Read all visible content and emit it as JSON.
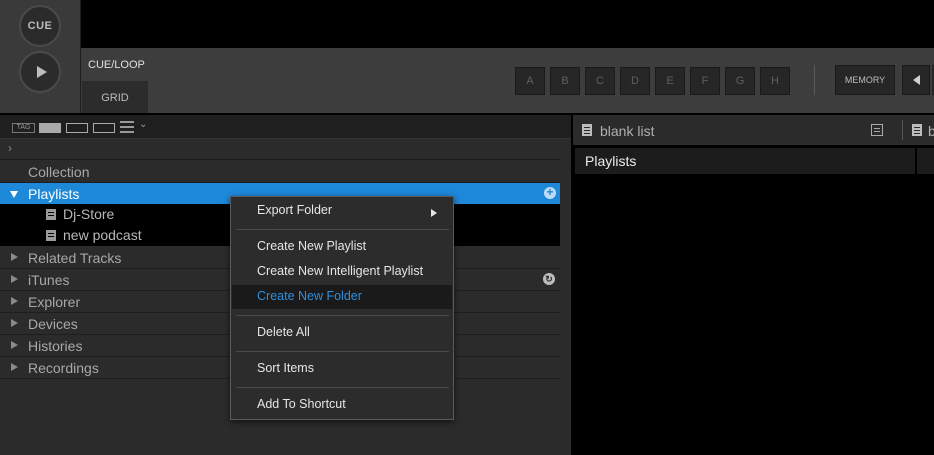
{
  "deck": {
    "cue_label": "CUE",
    "tabs": {
      "cue_loop": "CUE/LOOP",
      "grid": "GRID"
    },
    "hot_cues": [
      "A",
      "B",
      "C",
      "D",
      "E",
      "F",
      "G",
      "H"
    ],
    "memory_label": "MEMORY"
  },
  "tree": {
    "toolbar": {
      "tag_label": "TAG"
    },
    "items": [
      {
        "label": "Collection"
      },
      {
        "label": "Playlists"
      },
      {
        "label": "Related Tracks"
      },
      {
        "label": "iTunes"
      },
      {
        "label": "Explorer"
      },
      {
        "label": "Devices"
      },
      {
        "label": "Histories"
      },
      {
        "label": "Recordings"
      }
    ],
    "playlists": [
      {
        "label": "Dj-Store"
      },
      {
        "label": "new podcast"
      }
    ]
  },
  "right_panel": {
    "title": "blank list",
    "title2_fragment": "b",
    "column_header": "Playlists"
  },
  "context_menu": {
    "items": [
      {
        "label": "Export Folder",
        "submenu": true
      },
      {
        "label": "Create New Playlist"
      },
      {
        "label": "Create New Intelligent Playlist"
      },
      {
        "label": "Create New Folder",
        "highlighted": true
      },
      {
        "label": "Delete All"
      },
      {
        "label": "Sort Items"
      },
      {
        "label": "Add To Shortcut"
      }
    ]
  },
  "colors": {
    "selection_blue": "#1e88d9",
    "menu_highlight_text": "#2f8fe0",
    "panel_dark": "#2b2b2b"
  }
}
